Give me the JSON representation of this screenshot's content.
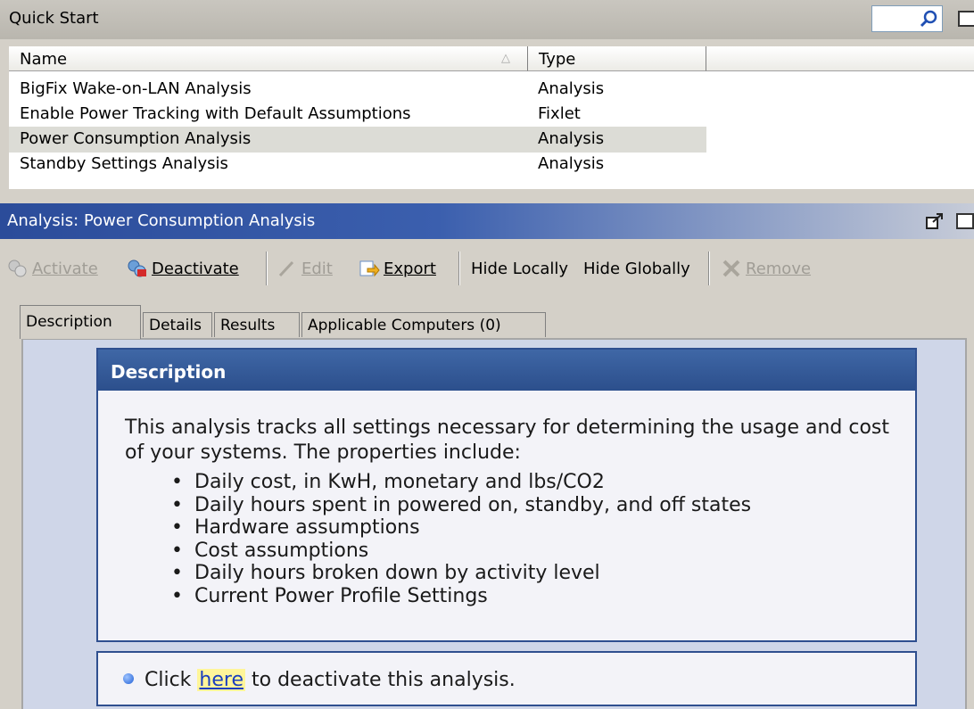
{
  "quick_start": {
    "title": "Quick Start",
    "columns": {
      "name": "Name",
      "type": "Type"
    },
    "rows": [
      {
        "name": "BigFix Wake-on-LAN Analysis",
        "type": "Analysis"
      },
      {
        "name": "Enable Power Tracking with Default Assumptions",
        "type": "Fixlet"
      },
      {
        "name": "Power Consumption Analysis",
        "type": "Analysis",
        "selected": true
      },
      {
        "name": "Standby Settings Analysis",
        "type": "Analysis"
      }
    ]
  },
  "analysis": {
    "title": "Analysis: Power Consumption Analysis",
    "toolbar": {
      "activate": "Activate",
      "deactivate": "Deactivate",
      "edit": "Edit",
      "export": "Export",
      "hide_locally": "Hide Locally",
      "hide_globally": "Hide Globally",
      "remove": "Remove"
    },
    "tabs": [
      "Description",
      "Details",
      "Results",
      "Applicable Computers (0)"
    ],
    "description": {
      "heading": "Description",
      "intro": "This analysis tracks all settings necessary for determining the usage and cost of your systems. The properties include:",
      "bullets": [
        "Daily cost, in KwH, monetary and lbs/CO2",
        "Daily hours spent in powered on, standby, and off states",
        "Hardware assumptions",
        "Cost assumptions",
        "Daily hours broken down by activity level",
        "Current Power Profile Settings"
      ],
      "action_prefix": "Click",
      "action_link": "here",
      "action_suffix": "to deactivate this analysis."
    }
  },
  "colors": {
    "header_blue": "#2b4c9a",
    "desc_border": "#2f4f8f",
    "link_highlight": "#fff59a"
  }
}
